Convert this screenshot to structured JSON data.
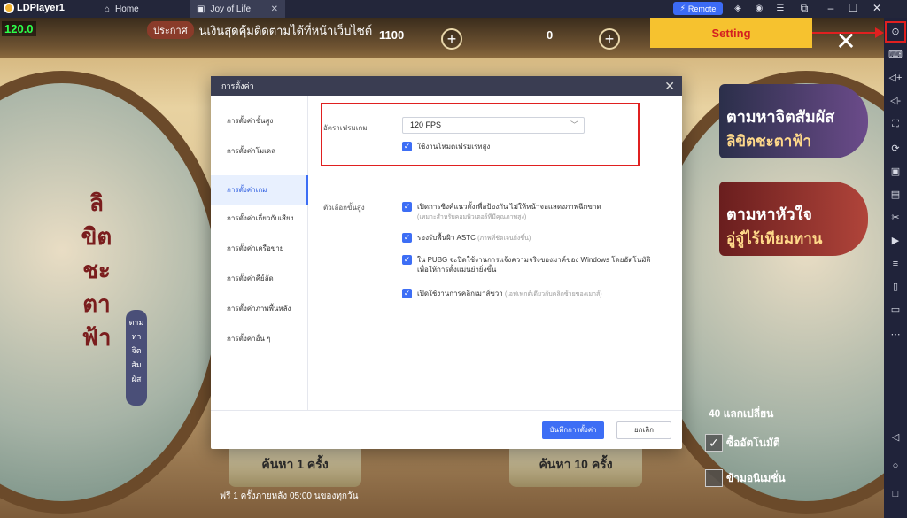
{
  "titlebar": {
    "app_name": "LDPlayer1",
    "tabs": [
      {
        "label": "Home"
      },
      {
        "label": "Joy of Life"
      }
    ],
    "remote_label": "Remote"
  },
  "game": {
    "fps_counter": "120.0",
    "announce_tag": "ประกาศ",
    "announce_text": "นเงินสุดคุ้มติดตามได้ที่หน้าเว็บไซต์",
    "currency1": "1100",
    "currency2": "0",
    "vertical_title": [
      "ลิ",
      "ขิต",
      "ชะ",
      "ตา",
      "ฟ้า"
    ],
    "vertical_sub": "ตาม หา จิต สัม ผัส",
    "promo1": {
      "line1": "ตามหาจิตสัมผัส",
      "line2": "ลิขิตชะตาฟ้า"
    },
    "promo2": {
      "line1": "ตามหาหัวใจ",
      "line2": "อู่จู๋ไร้เทียมทาน"
    },
    "exchange": "40 แลกเปลี่ยน",
    "option1": "ซื้ออัตโนมัติ",
    "option2": "ข้ามอนิเมชั่น",
    "draw1": "ค้นหา 1 ครั้ง",
    "draw2": "ค้นหา 10 ครั้ง",
    "draw_note": "ฟรี 1 ครั้งภายหลัง 05:00 นของทุกวัน"
  },
  "callout": {
    "label": "Setting",
    "color": "#f6c22f"
  },
  "dialog": {
    "title": "การตั้งค่า",
    "nav": [
      {
        "label": "การตั้งค่าขั้นสูง"
      },
      {
        "label": "การตั้งค่าโมเดล"
      },
      {
        "label": "การตั้งค่าเกม"
      },
      {
        "label": "การตั้งค่าเกี่ยวกับเสียง"
      },
      {
        "label": "การตั้งค่าเครือข่าย"
      },
      {
        "label": "การตั้งค่าคีย์ลัด"
      },
      {
        "label": "การตั้งค่าภาพพื้นหลัง"
      },
      {
        "label": "การตั้งค่าอื่น ๆ"
      }
    ],
    "active_nav_index": 2,
    "fps_label": "อัตราเฟรมเกม",
    "fps_value": "120 FPS",
    "high_fps_label": "ใช้งานโหมดเฟรมเรทสูง",
    "advanced_label": "ตัวเลือกขั้นสูง",
    "options": [
      {
        "text": "เปิดการซิงค์แนวตั้งเพื่อป้องกัน ไม่ให้หน้าจอแสดงภาพฉีกขาด",
        "sub": "(เหมาะสำหรับคอมพิวเตอร์ที่มีคุณภาพสูง)"
      },
      {
        "text": "รองรับพื้นผิว ASTC",
        "sub": "(ภาพที่ชัดเจนยิ่งขึ้น)"
      },
      {
        "text": "ใน PUBG จะปิดใช้งานการแจ้งความจริงของมาค์ของ Windows โดยอัตโนมัติ เพื่อให้การตั้งแม่นยำยิ่งขึ้น",
        "sub": ""
      },
      {
        "text": "เปิดใช้งานการคลิกเมาส์ขวา",
        "sub": "(เอฟเฟกต์เดียวกับคลิกซ้ายของเมาส์)"
      }
    ],
    "save_label": "บันทึกการตั้งค่า",
    "cancel_label": "ยกเลิก"
  },
  "colors": {
    "accent": "#3d6ef5",
    "highlight": "#e02020"
  }
}
